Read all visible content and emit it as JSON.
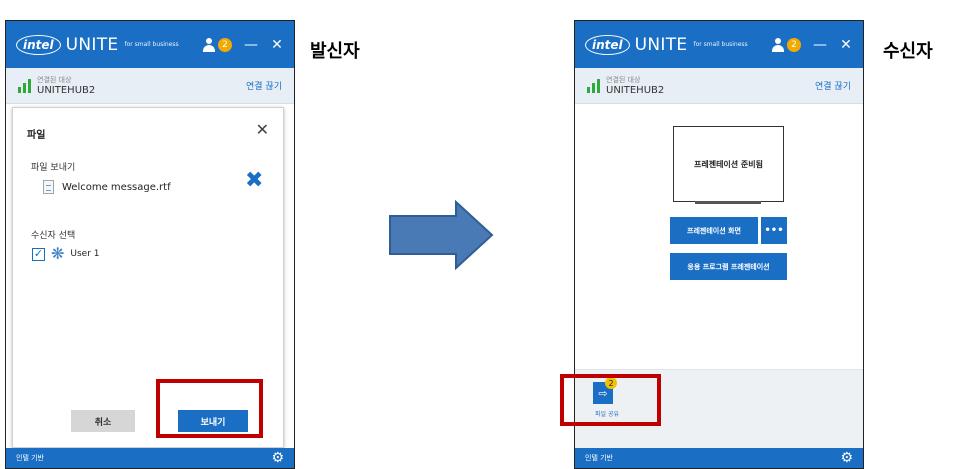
{
  "common": {
    "logo": "intel",
    "app_name": "UNITE",
    "tagline": "for small business",
    "user_count": "2",
    "minimize": "—",
    "close": "✕",
    "connected_label": "연결된 대상",
    "hub_name": "UNITEHUB2",
    "disconnect": "연결 끊기",
    "footer_text": "인텔 기반",
    "settings_icon": "gear-icon",
    "brand_color": "#1a6fc4"
  },
  "sender": {
    "side_label": "발신자",
    "dialog": {
      "title": "파일",
      "close": "✕",
      "send_file_heading": "파일 보내기",
      "file_name": "Welcome message.rtf",
      "remove": "✖",
      "select_recipient_heading": "수신자 선택",
      "recipient_checked": "✓",
      "recipient_icon": "❋",
      "recipient_name": "User 1",
      "cancel_label": "취소",
      "send_label": "보내기"
    }
  },
  "receiver": {
    "side_label": "수신자",
    "ready_text": "프레젠테이션 준비됨",
    "present_screen": "프레젠테이션 화면",
    "more": "•••",
    "present_app": "응용 프로그램 프레젠테이션",
    "file_share_badge": "2",
    "file_share_icon": "⇨",
    "file_share_label": "파일 공유"
  },
  "highlight_color": "#c00000",
  "arrow_color": "#4a7ab5"
}
